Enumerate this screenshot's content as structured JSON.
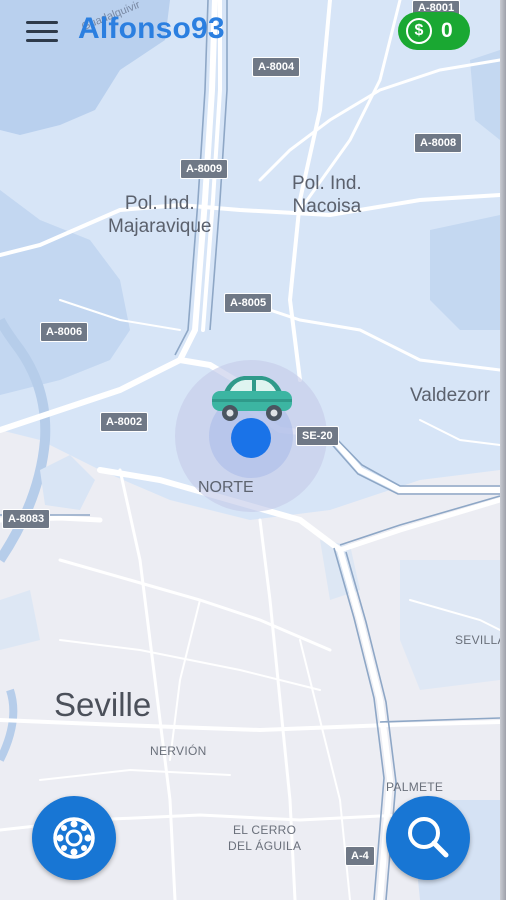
{
  "app": {
    "username": "Alfonso93",
    "coins": "0",
    "coin_symbol": "$"
  },
  "map": {
    "areas": {
      "majaravique": "Pol. Ind.\nMajaravique",
      "nacoisa": "Pol. Ind.\nNacoisa",
      "valdezorras": "Valdezorr",
      "norte": "NORTE",
      "seville": "Seville",
      "nervion": "NERVIÓN",
      "el_cerro": "EL CERRO\nDEL ÁGUILA",
      "palmete": "PALMETE",
      "sevilla_east": "SEVILLA",
      "guadalquivir": "Guadalquivir"
    },
    "roads": {
      "a8004": "A-8004",
      "a8008": "A-8008",
      "a8009": "A-8009",
      "a8005": "A-8005",
      "a8006": "A-8006",
      "a8002": "A-8002",
      "a8083": "A-8083",
      "se20": "SE-20",
      "a4": "A-4",
      "a8001": "A-8001"
    }
  },
  "icons": {
    "menu": "hamburger-menu-icon",
    "coin": "coin-icon",
    "car": "car-icon",
    "location": "location-dot-icon",
    "fab_left": "steering-wheel-icon",
    "fab_right": "search-icon"
  },
  "colors": {
    "accent": "#2b7fe0",
    "coin_green": "#1aa832",
    "fab_blue": "#1876d4",
    "map_blue_zone": "#d6e6f8",
    "road": "#ffffff",
    "location_dot": "#1a73e8"
  }
}
